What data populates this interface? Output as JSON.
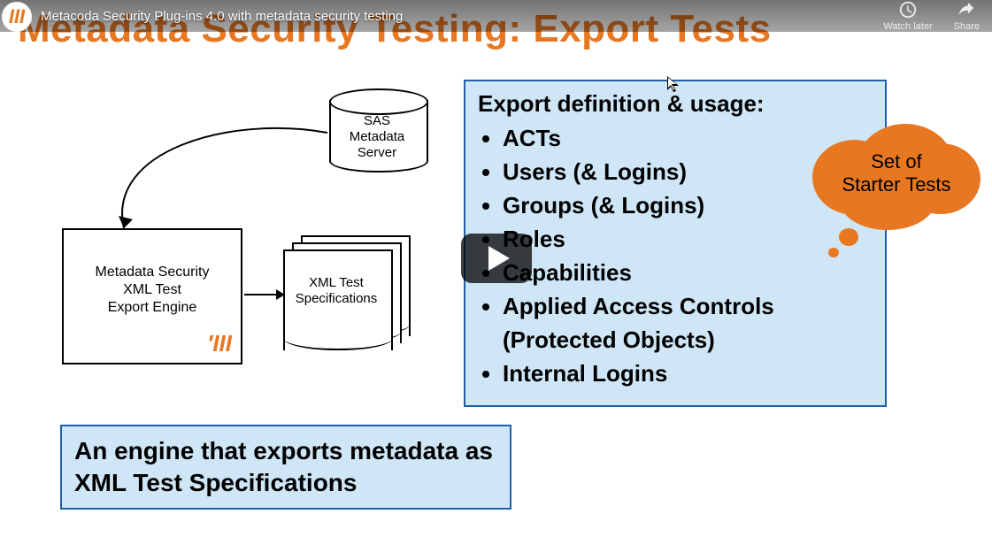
{
  "topbar": {
    "title": "Metacoda Security Plug-ins 4.0 with metadata security testing",
    "watch_later": "Watch later",
    "share": "Share"
  },
  "slide": {
    "title": "Metadata Security Testing: Export Tests",
    "db_label_1": "SAS",
    "db_label_2": "Metadata",
    "db_label_3": "Server",
    "engine_1": "Metadata Security",
    "engine_2": "XML Test",
    "engine_3": "Export Engine",
    "docs_1": "XML Test",
    "docs_2": "Specifications",
    "blue_heading": "Export definition & usage:",
    "items": [
      "ACTs",
      "Users (& Logins)",
      "Groups (& Logins)",
      "Roles",
      "Capabilities",
      "Applied Access Controls (Protected Objects)",
      "Internal Logins"
    ],
    "cloud_1": "Set of",
    "cloud_2": "Starter Tests",
    "caption": "An engine that exports metadata as XML Test Specifications"
  }
}
